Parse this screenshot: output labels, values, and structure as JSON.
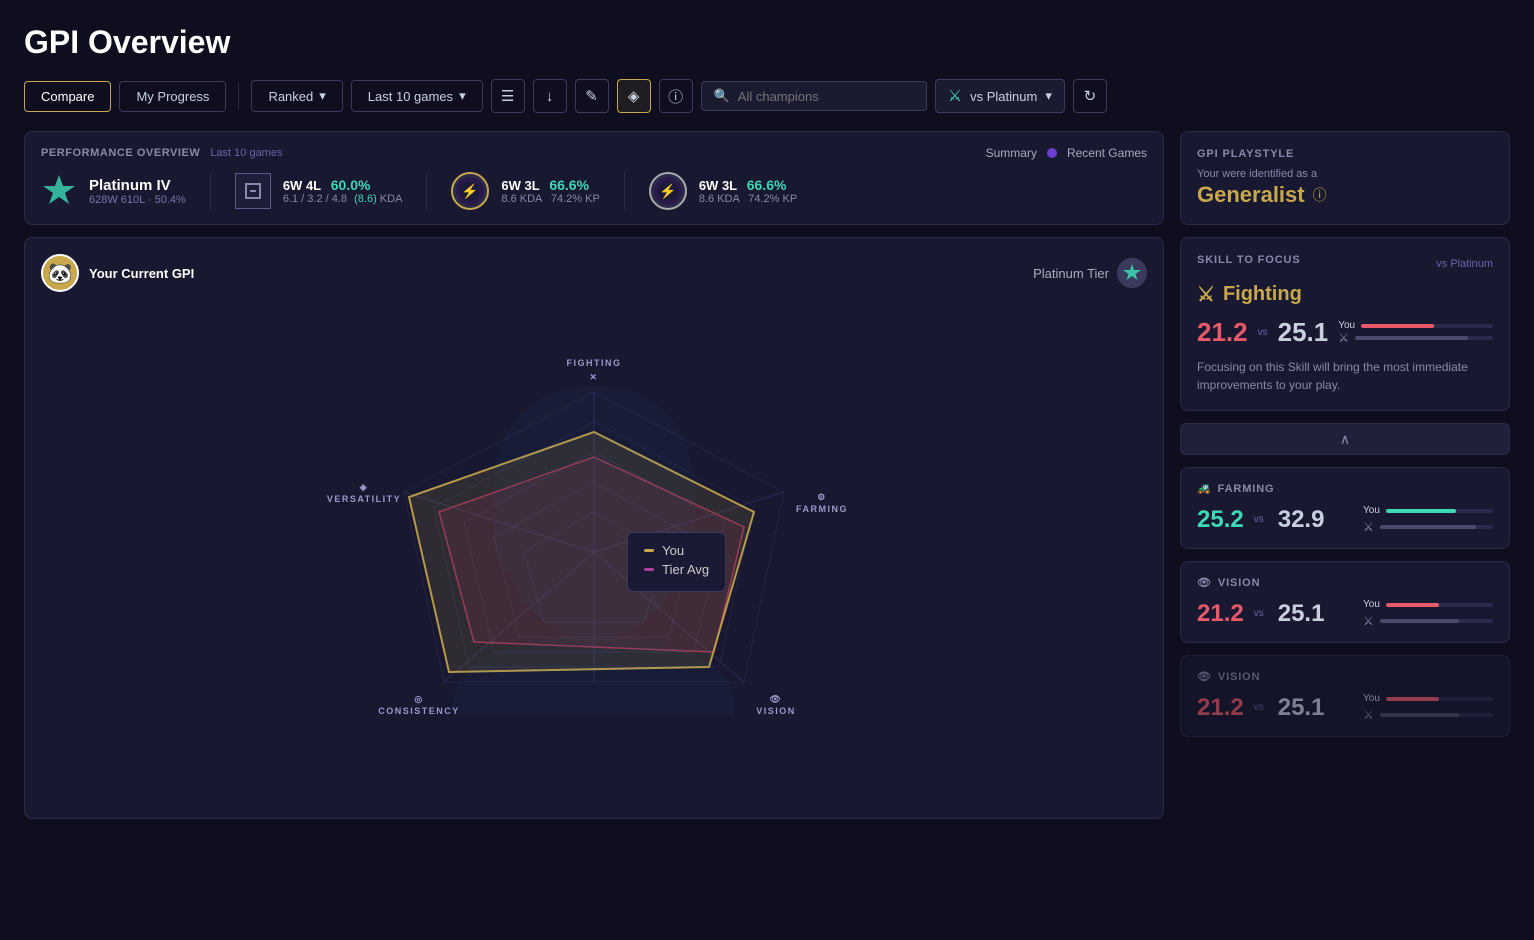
{
  "page": {
    "title": "GPI Overview"
  },
  "toolbar": {
    "compare_label": "Compare",
    "my_progress_label": "My Progress",
    "ranked_label": "Ranked",
    "last10_label": "Last 10 games",
    "all_champions_label": "All champions",
    "vs_platinum_label": "vs Platinum",
    "search_placeholder": "All champions"
  },
  "performance": {
    "title": "PERFORMANCE OVERVIEW",
    "subtitle": "Last 10 games",
    "summary_label": "Summary",
    "recent_games_label": "Recent Games",
    "rank": {
      "name": "Platinum IV",
      "sub": "628W 610L · 50.4%",
      "icon": "🏆"
    },
    "queue_stats": {
      "wins": "6W",
      "losses": "4L",
      "wr": "60.0%",
      "kda": "6.1 / 3.2 / 4.8",
      "kda_highlight": "(8.6)",
      "kda_label": "KDA",
      "icon": "⬛"
    },
    "champ1": {
      "wins": "6W",
      "losses": "3L",
      "wr": "66.6%",
      "kda": "8.6",
      "kp": "74.2%",
      "kda_label": "KDA",
      "kp_label": "KP",
      "icon": "🌑"
    },
    "champ2": {
      "wins": "6W",
      "losses": "3L",
      "wr": "66.6%",
      "kda": "8.6",
      "kp": "74.2%",
      "kda_label": "KDA",
      "kp_label": "KP",
      "icon": "🌑"
    }
  },
  "gpi": {
    "user_label": "Your Current GPI",
    "platinum_label": "Platinum Tier",
    "user_avatar": "🐼",
    "legend_you": "You",
    "legend_tier": "Tier Avg",
    "labels": {
      "fighting": "FIGHTING",
      "farming": "FARMING",
      "vision": "VISION",
      "consistency": "CONSISTENCY",
      "versatility": "VERSATILITY"
    }
  },
  "playstyle": {
    "title": "GPI PLAYSTYLE",
    "identified_label": "Your were identified as a",
    "type": "Generalist",
    "info_icon": "ⓘ"
  },
  "skill_focus": {
    "title": "SKILL TO FOCUS",
    "vs_label": "vs Platinum",
    "skill_name": "Fighting",
    "skill_icon": "⚔️",
    "you_score": "21.2",
    "vs_score": "25.1",
    "vs_text": "vs",
    "you_bar_pct": 55,
    "tier_bar_pct": 82,
    "description": "Focusing on this Skill will bring the most immediate improvements to your play."
  },
  "skills": [
    {
      "name": "FARMING",
      "icon": "🚜",
      "you_score": "25.2",
      "vs_score": "32.9",
      "vs_text": "vs",
      "color": "green",
      "you_bar_pct": 65,
      "tier_bar_pct": 85
    },
    {
      "name": "VISION",
      "icon": "👁",
      "you_score": "21.2",
      "vs_score": "25.1",
      "vs_text": "vs",
      "color": "red",
      "you_bar_pct": 50,
      "tier_bar_pct": 70
    },
    {
      "name": "VISION",
      "icon": "👁",
      "you_score": "21.2",
      "vs_score": "25.1",
      "vs_text": "vs",
      "color": "red",
      "you_bar_pct": 50,
      "tier_bar_pct": 70
    }
  ],
  "colors": {
    "accent_gold": "#c8a84b",
    "accent_green": "#3dd9b5",
    "accent_red": "#e85a6a",
    "accent_purple": "#6a3fd0",
    "bg_dark": "#0e0e1e",
    "bg_card": "#181830"
  }
}
